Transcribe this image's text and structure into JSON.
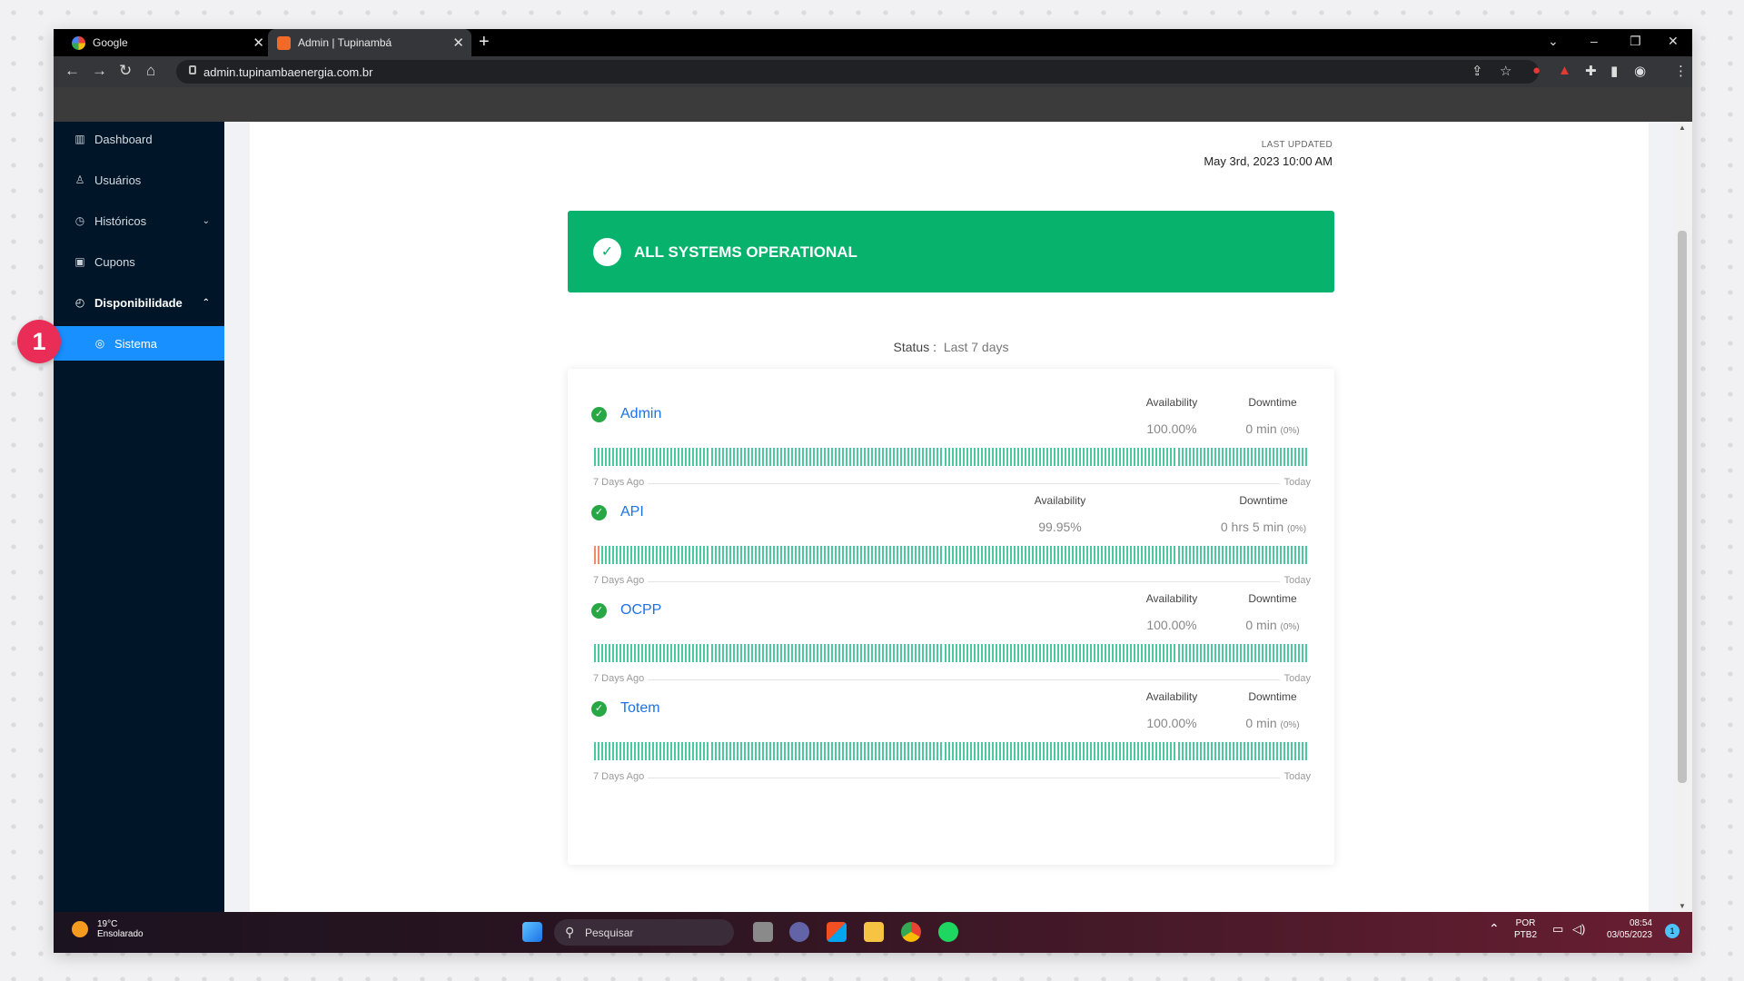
{
  "browser": {
    "tabs": [
      {
        "title": "Google",
        "favicon_color": "#ffffff"
      },
      {
        "title": "Admin | Tupinambá",
        "favicon_color": "#f06a2a"
      }
    ],
    "url": "admin.tupinambaenergia.com.br"
  },
  "sidebar": {
    "items": [
      {
        "label": "Dashboard",
        "icon": "bar-chart-icon"
      },
      {
        "label": "Usuários",
        "icon": "user-icon"
      },
      {
        "label": "Históricos",
        "icon": "history-icon"
      },
      {
        "label": "Cupons",
        "icon": "gift-icon"
      },
      {
        "label": "Disponibilidade",
        "icon": "clock-icon"
      },
      {
        "label": "Sistema",
        "icon": "eye-icon"
      }
    ]
  },
  "status_page": {
    "last_updated_label": "LAST UPDATED",
    "last_updated_value": "May 3rd, 2023 10:00 AM",
    "banner_text": "ALL SYSTEMS OPERATIONAL",
    "status_label": "Status :",
    "status_value": "Last 7 days",
    "availability_label": "Availability",
    "downtime_label": "Downtime",
    "axis_start": "7 Days Ago",
    "axis_end": "Today",
    "services": [
      {
        "name": "Admin",
        "availability": "100.00%",
        "downtime": "0 min",
        "downtime_pct": "(0%)",
        "incident_bars": 0
      },
      {
        "name": "API",
        "availability": "99.95%",
        "downtime": "0 hrs 5 min",
        "downtime_pct": "(0%)",
        "incident_bars": 2
      },
      {
        "name": "OCPP",
        "availability": "100.00%",
        "downtime": "0 min",
        "downtime_pct": "(0%)",
        "incident_bars": 0
      },
      {
        "name": "Totem",
        "availability": "100.00%",
        "downtime": "0 min",
        "downtime_pct": "(0%)",
        "incident_bars": 0
      }
    ]
  },
  "colors": {
    "sidebar_bg": "#001528",
    "sidebar_active": "#1890ff",
    "operational_green": "#06b26c",
    "bar_ok": "#49c99d",
    "bar_incident": "#f08b6e",
    "link_blue": "#1a73e8",
    "callout": "#e92d57"
  },
  "taskbar": {
    "weather_temp": "19°C",
    "weather_desc": "Ensolarado",
    "search_placeholder": "Pesquisar",
    "lang_top": "POR",
    "lang_bottom": "PTB2",
    "time": "08:54",
    "date": "03/05/2023",
    "notification_count": "1"
  },
  "callout_number": "1"
}
